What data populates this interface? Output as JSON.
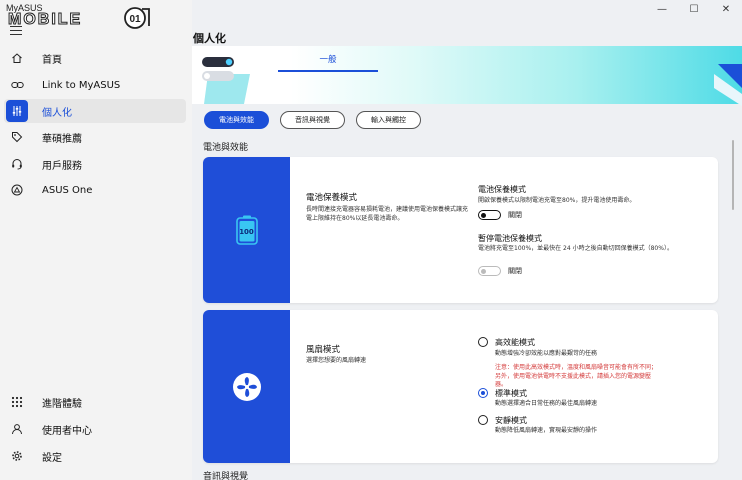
{
  "app": {
    "brand_small": "MyASUS",
    "brand_large": "MOBILE",
    "badge_text": "01"
  },
  "window_controls": {
    "minimize": "—",
    "maximize": "☐",
    "close": "✕"
  },
  "sidebar": {
    "items": [
      {
        "label": "首頁",
        "icon": "home-icon"
      },
      {
        "label": "Link to MyASUS",
        "icon": "link-icon"
      },
      {
        "label": "個人化",
        "icon": "sliders-icon",
        "active": true
      },
      {
        "label": "華碩推薦",
        "icon": "tag-icon"
      },
      {
        "label": "用戶服務",
        "icon": "headset-icon"
      },
      {
        "label": "ASUS One",
        "icon": "asus-one-icon"
      }
    ],
    "bottom_items": [
      {
        "label": "進階體驗",
        "icon": "grid-icon"
      },
      {
        "label": "使用者中心",
        "icon": "user-icon"
      },
      {
        "label": "設定",
        "icon": "gear-icon"
      }
    ]
  },
  "page": {
    "title": "個人化",
    "tab": "一般",
    "chips": [
      "電池與效能",
      "音訊與視覺",
      "輸入與觸控"
    ],
    "active_chip": 0
  },
  "battery_section": {
    "label": "電池與效能",
    "card_title": "電池保養模式",
    "card_desc": "長時間連接充電器容易損耗電池，建議使用電池保養模式讓充電上限維持在80%以延長電池壽命。",
    "battery_level": "100",
    "options": [
      {
        "title": "電池保養模式",
        "desc": "開啟保養模式以限制電池充電至80%，提升電池使用壽命。",
        "toggle_label": "關閉",
        "enabled": true
      },
      {
        "title": "暫停電池保養模式",
        "desc": "電池將充電至100%，並最快在 24 小時之後自動切回保養模式（80%）。",
        "toggle_label": "關閉",
        "enabled": false
      }
    ]
  },
  "fan_section": {
    "card_title": "風扇模式",
    "card_desc": "選擇您想要的風扇轉速",
    "options": [
      {
        "title": "高效能模式",
        "desc": "動態增強冷卻效能以應對最艱苛的任務",
        "warning": "注意：使用此高效模式時，溫度和風扇噪音可能會有所不同；另外，使用電池供電時不支援此模式，請插入您的電源變壓器。"
      },
      {
        "title": "標準模式",
        "desc": "動態選擇適合日常任務的最佳風扇轉速",
        "selected": true
      },
      {
        "title": "安靜模式",
        "desc": "動態降低風扇轉速，實現最安靜的操作"
      }
    ]
  },
  "audio_section": {
    "label": "音訊與視覺"
  },
  "colors": {
    "accent": "#1b4fd8",
    "warning": "#d43b3b",
    "hero_cyan": "#4edbe6"
  }
}
